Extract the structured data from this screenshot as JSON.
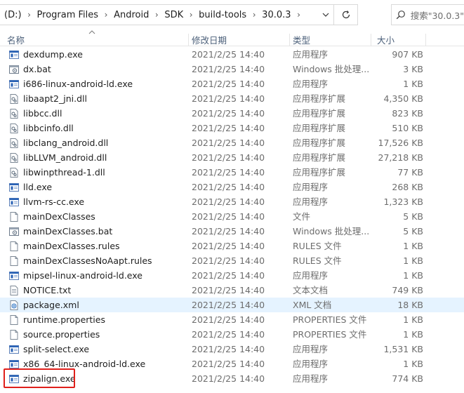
{
  "address": {
    "crumbs": [
      "(D:)",
      "Program Files",
      "Android",
      "SDK",
      "build-tools",
      "30.0.3"
    ]
  },
  "search": {
    "placeholder": "搜索\"30.0.3\""
  },
  "columns": {
    "name": "名称",
    "date": "修改日期",
    "type": "类型",
    "size": "大小"
  },
  "files": [
    {
      "name": "dexdump.exe",
      "date": "2021/2/25 14:40",
      "type": "应用程序",
      "size": "907 KB",
      "icon": "exe"
    },
    {
      "name": "dx.bat",
      "date": "2021/2/25 14:40",
      "type": "Windows 批处理...",
      "size": "3 KB",
      "icon": "bat"
    },
    {
      "name": "i686-linux-android-ld.exe",
      "date": "2021/2/25 14:40",
      "type": "应用程序",
      "size": "1 KB",
      "icon": "exe"
    },
    {
      "name": "libaapt2_jni.dll",
      "date": "2021/2/25 14:40",
      "type": "应用程序扩展",
      "size": "4,350 KB",
      "icon": "dll"
    },
    {
      "name": "libbcc.dll",
      "date": "2021/2/25 14:40",
      "type": "应用程序扩展",
      "size": "823 KB",
      "icon": "dll"
    },
    {
      "name": "libbcinfo.dll",
      "date": "2021/2/25 14:40",
      "type": "应用程序扩展",
      "size": "510 KB",
      "icon": "dll"
    },
    {
      "name": "libclang_android.dll",
      "date": "2021/2/25 14:40",
      "type": "应用程序扩展",
      "size": "17,526 KB",
      "icon": "dll"
    },
    {
      "name": "libLLVM_android.dll",
      "date": "2021/2/25 14:40",
      "type": "应用程序扩展",
      "size": "27,218 KB",
      "icon": "dll"
    },
    {
      "name": "libwinpthread-1.dll",
      "date": "2021/2/25 14:40",
      "type": "应用程序扩展",
      "size": "77 KB",
      "icon": "dll"
    },
    {
      "name": "lld.exe",
      "date": "2021/2/25 14:40",
      "type": "应用程序",
      "size": "268 KB",
      "icon": "exe"
    },
    {
      "name": "llvm-rs-cc.exe",
      "date": "2021/2/25 14:40",
      "type": "应用程序",
      "size": "1,323 KB",
      "icon": "exe"
    },
    {
      "name": "mainDexClasses",
      "date": "2021/2/25 14:40",
      "type": "文件",
      "size": "5 KB",
      "icon": "file"
    },
    {
      "name": "mainDexClasses.bat",
      "date": "2021/2/25 14:40",
      "type": "Windows 批处理...",
      "size": "5 KB",
      "icon": "bat"
    },
    {
      "name": "mainDexClasses.rules",
      "date": "2021/2/25 14:40",
      "type": "RULES 文件",
      "size": "1 KB",
      "icon": "file"
    },
    {
      "name": "mainDexClassesNoAapt.rules",
      "date": "2021/2/25 14:40",
      "type": "RULES 文件",
      "size": "1 KB",
      "icon": "file"
    },
    {
      "name": "mipsel-linux-android-ld.exe",
      "date": "2021/2/25 14:40",
      "type": "应用程序",
      "size": "1 KB",
      "icon": "exe"
    },
    {
      "name": "NOTICE.txt",
      "date": "2021/2/25 14:40",
      "type": "文本文档",
      "size": "749 KB",
      "icon": "txt"
    },
    {
      "name": "package.xml",
      "date": "2021/2/25 14:40",
      "type": "XML 文档",
      "size": "18 KB",
      "icon": "xml",
      "selected": true
    },
    {
      "name": "runtime.properties",
      "date": "2021/2/25 14:40",
      "type": "PROPERTIES 文件",
      "size": "1 KB",
      "icon": "file"
    },
    {
      "name": "source.properties",
      "date": "2021/2/25 14:40",
      "type": "PROPERTIES 文件",
      "size": "1 KB",
      "icon": "file"
    },
    {
      "name": "split-select.exe",
      "date": "2021/2/25 14:40",
      "type": "应用程序",
      "size": "1,531 KB",
      "icon": "exe"
    },
    {
      "name": "x86_64-linux-android-ld.exe",
      "date": "2021/2/25 14:40",
      "type": "应用程序",
      "size": "1 KB",
      "icon": "exe"
    },
    {
      "name": "zipalign.exe",
      "date": "2021/2/25 14:40",
      "type": "应用程序",
      "size": "774 KB",
      "icon": "exe",
      "highlighted": true
    }
  ],
  "colors": {
    "selected_row": "#e5f3ff",
    "highlight_border": "#e0201b",
    "header_text": "#4c607a",
    "exe_icon_blue": "#2b63b6"
  }
}
